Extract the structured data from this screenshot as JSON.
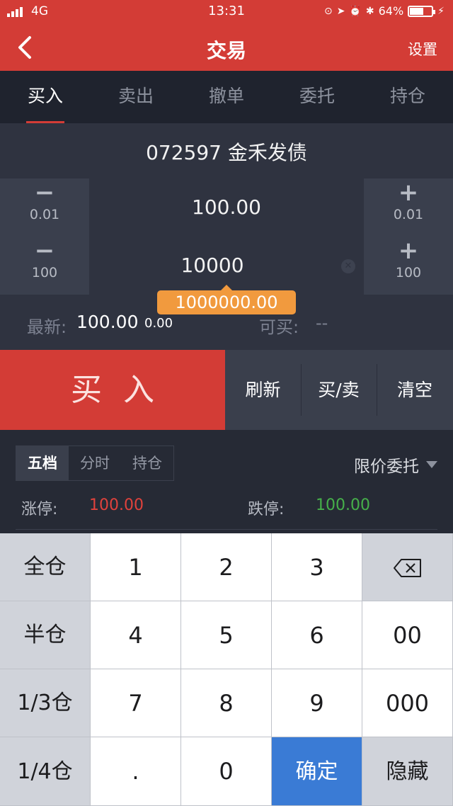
{
  "status_bar": {
    "network": "4G",
    "time": "13:31",
    "battery_percent": "64%",
    "battery_level": 0.64
  },
  "nav": {
    "title": "交易",
    "settings_label": "设置"
  },
  "tabs": [
    {
      "label": "买入",
      "active": true
    },
    {
      "label": "卖出",
      "active": false
    },
    {
      "label": "撤单",
      "active": false
    },
    {
      "label": "委托",
      "active": false
    },
    {
      "label": "持仓",
      "active": false
    }
  ],
  "order": {
    "stock": "072597 金禾发债",
    "price": "100.00",
    "quantity": "10000",
    "total": "1000000.00",
    "price_step": "0.01",
    "qty_step": "100",
    "minus": "−",
    "plus": "+",
    "latest_label": "最新:",
    "latest_price": "100.00",
    "latest_change": "0.00",
    "can_buy_label": "可买:",
    "can_buy_value": "--"
  },
  "actions": {
    "buy": "买入",
    "refresh": "刷新",
    "buy_sell": "买/卖",
    "clear": "清空"
  },
  "market": {
    "segments": [
      "五档",
      "分时",
      "持仓"
    ],
    "order_type": "限价委托",
    "limit_up_label": "涨停:",
    "limit_up_value": "100.00",
    "limit_down_label": "跌停:",
    "limit_down_value": "100.00"
  },
  "keypad": {
    "full": "全仓",
    "half": "半仓",
    "third": "1/3仓",
    "quarter": "1/4仓",
    "k1": "1",
    "k2": "2",
    "k3": "3",
    "k4": "4",
    "k5": "5",
    "k6": "6",
    "k7": "7",
    "k8": "8",
    "k9": "9",
    "dot": ".",
    "k0": "0",
    "k00": "00",
    "k000": "000",
    "confirm": "确定",
    "hide": "隐藏"
  },
  "colors": {
    "brand_red": "#d33c36",
    "badge_orange": "#f19a3e",
    "up_red": "#e0423c",
    "down_green": "#46b04a",
    "confirm_blue": "#3a7bd5"
  }
}
